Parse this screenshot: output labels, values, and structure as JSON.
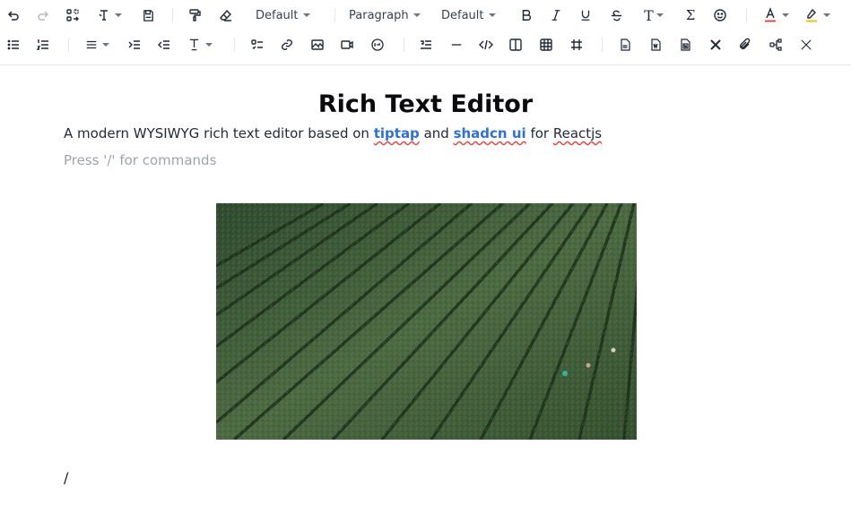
{
  "toolbar": {
    "font_family": "Default",
    "block_type": "Paragraph",
    "font_size": "Default",
    "icons": [
      "undo-icon",
      "redo-icon",
      "clear-format-icon",
      "format-menu-icon",
      "save-icon",
      "format-painter-icon",
      "eraser-icon",
      "bold-icon",
      "italic-icon",
      "underline-icon",
      "strikethrough-icon",
      "text-case-icon",
      "formula-icon",
      "emoji-icon",
      "text-color-icon",
      "highlight-icon",
      "bullet-list-icon",
      "ordered-list-icon",
      "align-icon",
      "indent-icon",
      "outdent-icon",
      "line-height-icon",
      "task-list-icon",
      "link-icon",
      "image-icon",
      "video-icon",
      "gif-icon",
      "blockquote-icon",
      "horizontal-rule-icon",
      "code-block-icon",
      "columns-icon",
      "table-icon",
      "hashtag-icon",
      "export-pdf-icon",
      "import-word-icon",
      "export-word-icon",
      "excalidraw-icon",
      "attachment-icon",
      "mind-map-icon",
      "twitter-x-icon"
    ],
    "text_color": "#e24848",
    "highlight_color": "#f2c200"
  },
  "document": {
    "title": "Rich Text Editor",
    "lead_before": "A modern WYSIWYG rich text editor based on ",
    "link1": "tiptap",
    "lead_and": " and ",
    "link2": "shadcn ui",
    "lead_for": " for ",
    "lead_end": "Reactjs",
    "placeholder": "Press '/' for commands",
    "image_subject": "aerial view of green tea plantation rows with workers",
    "slash_text": "/"
  },
  "colors": {
    "link": "#2f6fe0",
    "spellcheck": "#e24848",
    "placeholder": "#9ca3af"
  }
}
